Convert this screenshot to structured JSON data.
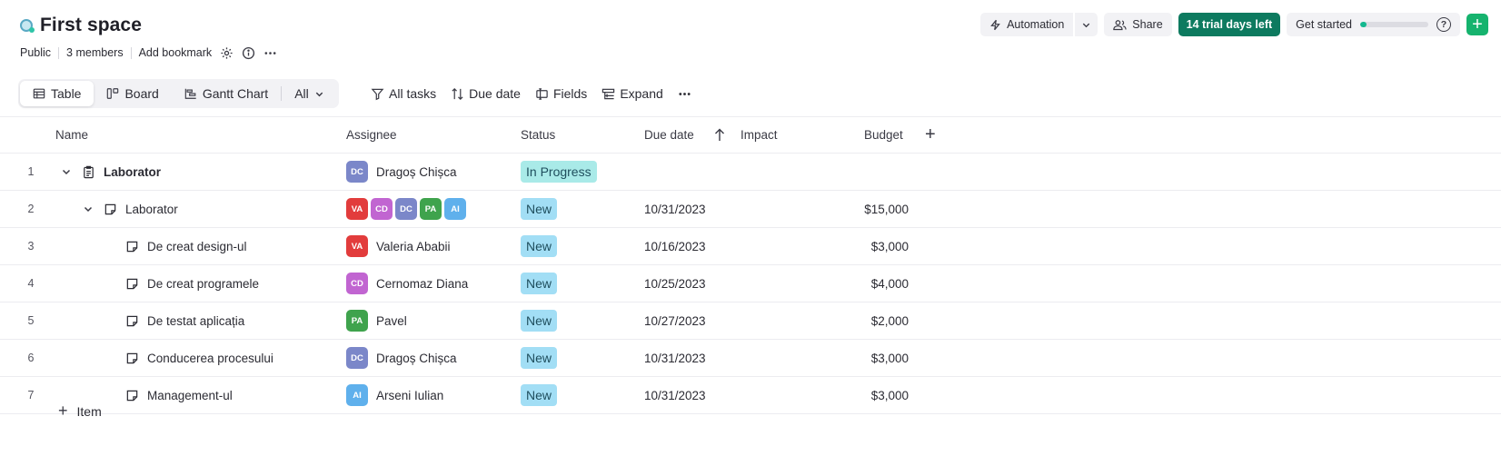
{
  "header": {
    "title": "First space",
    "visibility": "Public",
    "members": "3 members",
    "bookmark": "Add bookmark"
  },
  "actions": {
    "automation": "Automation",
    "share": "Share",
    "trial": "14 trial days left",
    "get_started": "Get started",
    "get_started_progress": 0.09,
    "help": "?",
    "add": "+"
  },
  "views": [
    {
      "label": "Table",
      "icon": "table-icon",
      "active": true
    },
    {
      "label": "Board",
      "icon": "board-icon",
      "active": false
    },
    {
      "label": "Gantt Chart",
      "icon": "gantt-icon",
      "active": false
    },
    {
      "label": "All",
      "icon": "chevron-down-icon",
      "active": false
    }
  ],
  "toolbar": {
    "filter": "All tasks",
    "sort": "Due date",
    "fields": "Fields",
    "expand": "Expand"
  },
  "columns": {
    "name": "Name",
    "assignee": "Assignee",
    "status": "Status",
    "due": "Due date",
    "impact": "Impact",
    "budget": "Budget"
  },
  "rows": [
    {
      "num": "1",
      "name": "Laborator",
      "assignee": "Dragoș Chișca",
      "status": "In Progress",
      "due": "",
      "budget": ""
    },
    {
      "num": "2",
      "name": "Laborator",
      "assignee": "",
      "status": "New",
      "due": "10/31/2023",
      "budget": "$15,000"
    },
    {
      "num": "3",
      "name": "De creat design-ul",
      "assignee": "Valeria Ababii",
      "status": "New",
      "due": "10/16/2023",
      "budget": "$3,000"
    },
    {
      "num": "4",
      "name": "De creat programele",
      "assignee": "Cernomaz Diana",
      "status": "New",
      "due": "10/25/2023",
      "budget": "$4,000"
    },
    {
      "num": "5",
      "name": "De testat aplicația",
      "assignee": "Pavel",
      "status": "New",
      "due": "10/27/2023",
      "budget": "$2,000"
    },
    {
      "num": "6",
      "name": "Conducerea procesului",
      "assignee": "Dragoș Chișca",
      "status": "New",
      "due": "10/31/2023",
      "budget": "$3,000"
    },
    {
      "num": "7",
      "name": "Management-ul",
      "assignee": "Arseni Iulian",
      "status": "New",
      "due": "10/31/2023",
      "budget": "$3,000"
    }
  ],
  "avatars": {
    "dc": {
      "initials": "DC",
      "color": "#7b87c9"
    },
    "va": {
      "initials": "VA",
      "color": "#e23c3c"
    },
    "cd": {
      "initials": "CD",
      "color": "#c165d1"
    },
    "pa": {
      "initials": "PA",
      "color": "#3fa34d"
    },
    "ai": {
      "initials": "AI",
      "color": "#5fb0ec"
    }
  },
  "status_colors": {
    "in_progress": "#a9eae8",
    "new": "#a2def5"
  },
  "footer": {
    "add_item": "Item"
  }
}
